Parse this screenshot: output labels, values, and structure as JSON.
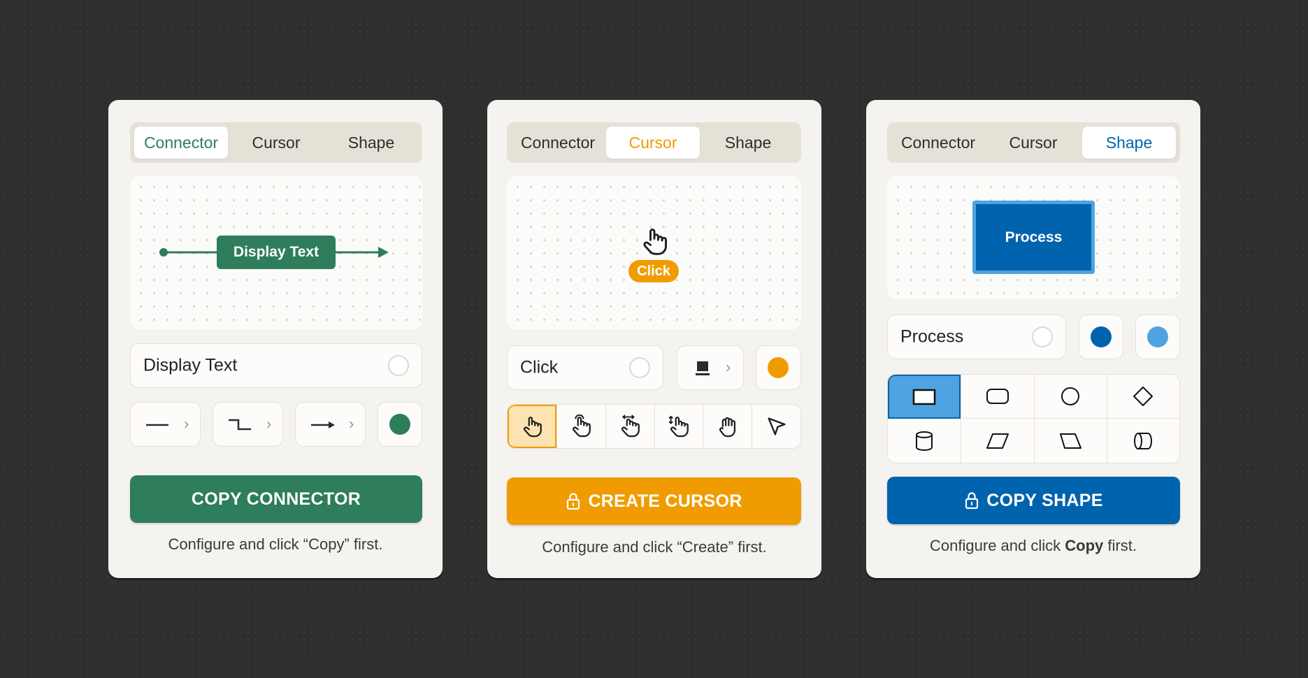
{
  "tabs": [
    "Connector",
    "Cursor",
    "Shape"
  ],
  "colors": {
    "connector_accent": "#2e7d5b",
    "cursor_accent": "#f09c00",
    "shape_accent": "#0063ad",
    "shape_light": "#4ea3e0"
  },
  "connector": {
    "preview_label": "Display Text",
    "text_value": "Display Text",
    "line_styles": [
      "straight-line-icon",
      "elbow-line-icon",
      "arrow-line-icon"
    ],
    "color_swatch": "#2e7d5b",
    "button_label": "COPY CONNECTOR",
    "hint": "Configure and click “Copy” first."
  },
  "cursor": {
    "preview_label": "Click",
    "text_value": "Click",
    "style_icon": "tooltip-style-icon",
    "color_swatch": "#f09c00",
    "cursor_types": [
      "pointer-hand-icon",
      "tap-hand-icon",
      "swipe-hand-icon",
      "drag-hand-icon",
      "grab-hand-icon",
      "arrow-cursor-icon"
    ],
    "selected_index": 0,
    "button_icon": "lock-icon",
    "button_label": "CREATE CURSOR",
    "hint": "Configure and click “Create” first."
  },
  "shape": {
    "preview_label": "Process",
    "text_value": "Process",
    "fill_color": "#0063ad",
    "border_color": "#4ea3e0",
    "shapes": [
      "rectangle-icon",
      "rounded-rectangle-icon",
      "circle-icon",
      "diamond-icon",
      "cylinder-icon",
      "parallelogram-icon",
      "trapezoid-icon",
      "horizontal-cylinder-icon"
    ],
    "selected_index": 0,
    "button_icon": "lock-icon",
    "button_label": "COPY SHAPE",
    "hint_prefix": "Configure and click ",
    "hint_bold": "Copy",
    "hint_suffix": " first."
  }
}
